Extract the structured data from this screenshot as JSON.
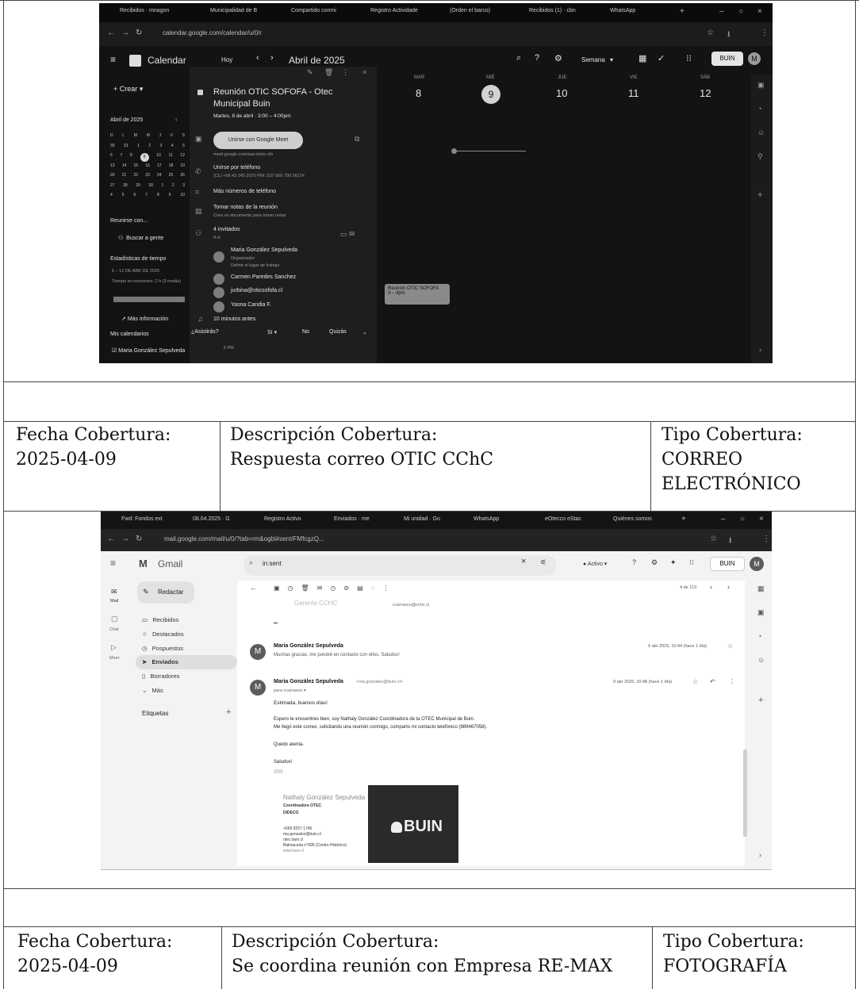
{
  "calendar_shot": {
    "tabs": [
      "Recibidos · mnagon",
      "Municipalidad de B",
      "Compartido conmi",
      "Registro Actividade",
      "(Orden el barco)",
      "Recibidos (1) · cbn",
      "WhatsApp"
    ],
    "url": "calendar.google.com/calendar/u/0/r",
    "app_name": "Calendar",
    "today_btn": "Hoy",
    "month_label": "Abril de 2025",
    "view": "Semana",
    "account": "BUIN",
    "user_initial": "M",
    "create_btn": "Crear",
    "mini_title": "Abril de 2025",
    "mini_weekdays": [
      "D",
      "L",
      "M",
      "M",
      "J",
      "V",
      "S"
    ],
    "mini_rows": [
      [
        "30",
        "31",
        "1",
        "2",
        "3",
        "4",
        "5"
      ],
      [
        "6",
        "7",
        "8",
        "9",
        "10",
        "11",
        "12"
      ],
      [
        "13",
        "14",
        "15",
        "16",
        "17",
        "18",
        "19"
      ],
      [
        "20",
        "21",
        "22",
        "23",
        "24",
        "25",
        "26"
      ],
      [
        "27",
        "28",
        "29",
        "30",
        "1",
        "2",
        "3"
      ],
      [
        "4",
        "5",
        "6",
        "7",
        "8",
        "9",
        "10"
      ]
    ],
    "meet_with": "Reunirse con...",
    "search_people": "Buscar a gente",
    "stats_title": "Estadísticas de tiempo",
    "stats_range": "6 – 12 DE ABR DE 2025",
    "stats_text": "Tiempo en reuniones: 2 h (3 media)",
    "more_info": "Más información",
    "my_calendars": "Mis calendarios",
    "my_calendar_item": "Maria González Sepulveda",
    "day_headers": [
      {
        "dow": "MAR",
        "num": "8"
      },
      {
        "dow": "MIÉ",
        "num": "9"
      },
      {
        "dow": "JUE",
        "num": "10"
      },
      {
        "dow": "VIE",
        "num": "11"
      },
      {
        "dow": "SÁB",
        "num": "12"
      }
    ],
    "event": {
      "title": "Reunión OTIC SOFOFA - Otec Municipal Buin",
      "when": "Martes, 8 de abril · 3:00 – 4:00pm",
      "meet_btn": "Unirse con Google Meet",
      "meet_link": "meet.google.com/aaz-ketm-xfs",
      "phone_title": "Unirse por teléfono",
      "phone": "(CL) +56 43 245 2070 PIN: 537 566 790 3617#",
      "more_numbers": "Más números de teléfono",
      "notes_title": "Tomar notas de la reunión",
      "notes_sub": "Crea un documento para tomar notas",
      "guests_title": "4 invitados",
      "guests_sub": "4 sí",
      "guests": [
        {
          "name": "Maria González Sepulveda",
          "sub1": "Organizador",
          "sub2": "Definir el lugar de trabajo"
        },
        {
          "name": "Carmen Paredes Sanchez",
          "sub1": "",
          "sub2": ""
        },
        {
          "name": "jurbina@oticsofofa.cl",
          "sub1": "",
          "sub2": ""
        },
        {
          "name": "Yasna Candia F.",
          "sub1": "",
          "sub2": ""
        }
      ],
      "reminder": "10 minutos antes",
      "rsvp_q": "¿Asistirás?",
      "rsvp_yes": "Sí",
      "rsvp_no": "No",
      "rsvp_maybe": "Quizás"
    },
    "chip_title": "Reunión OTIC SOFOFA",
    "chip_time": "3 – 4pm",
    "time_label": "5 PM"
  },
  "row1": {
    "fecha_label": "Fecha Cobertura:",
    "fecha_value": "2025-04-09",
    "desc_label": "Descripción Cobertura:",
    "desc_value": "Respuesta correo OTIC CChC",
    "tipo_label": "Tipo Cobertura:",
    "tipo_value_1": "CORREO",
    "tipo_value_2": "ELECTRÓNICO"
  },
  "gmail_shot": {
    "tabs": [
      "Fwd: Fondos ext",
      "08.04.2025 · G",
      "Registro Activo",
      "Enviados · me",
      "Mi unidad · Go",
      "WhatsApp",
      "eOtecco eStac",
      "Quiénes somos"
    ],
    "url": "mail.google.com/mail/u/0/?tab=rm&ogbl#sent/FMfcgzQ...",
    "app_name": "Gmail",
    "search_value": "in:sent",
    "status": "Activo",
    "account": "BUIN",
    "user_initial": "M",
    "compose": "Redactar",
    "rail": [
      "Mail",
      "Chat",
      "Meet"
    ],
    "nav": [
      "Recibidos",
      "Destacados",
      "Pospuestos",
      "Enviados",
      "Borradores",
      "Más"
    ],
    "labels_title": "Etiquetas",
    "pager": "4 de 113",
    "prev_to": "ccarrasco@cchc.cl",
    "prev_from": "Gerente CCHC",
    "msg1": {
      "from": "Maria González Sepulveda",
      "snippet": "Muchas gracias, me pondré en contacto con ellos. Saludos!",
      "date": "9 abr 2025, 10:44 (hace 1 día)"
    },
    "msg2": {
      "from": "Maria González Sepulveda",
      "from_email": "<ma.gonzalez@buin.cl>",
      "to": "para ccarrasco",
      "date": "9 abr 2025, 10:48 (hace 1 día)",
      "greeting": "Estimada, buenos días!",
      "body1": "Espero te encuentres bien, soy Nathaly González Coordinadora de la OTEC Municipal de Buin.",
      "body2": "Me llegó este correo, solicitando una reunión conmigo, comparto mi contacto telefónico (989467058).",
      "closing": "Quedo atenta.",
      "regards": "Saludos!"
    },
    "signature": {
      "name": "Nathaly González Sepulveda",
      "role": "Coordinadora OTEC",
      "dept": "DIDECO",
      "phone": "+569 9257 1746",
      "email": "ma.gonzalez@buin.cl",
      "site": "otec.buin.cl",
      "address": "Balmaceda n°995 (Centro Histórico)",
      "web": "www.buin.cl",
      "logo": "BUIN"
    }
  },
  "row2": {
    "fecha_label": "Fecha Cobertura:",
    "fecha_value": "2025-04-09",
    "desc_label": "Descripción Cobertura:",
    "desc_value": "Se coordina reunión con Empresa RE-MAX",
    "tipo_label": "Tipo Cobertura:",
    "tipo_value": "FOTOGRAFÍA"
  }
}
